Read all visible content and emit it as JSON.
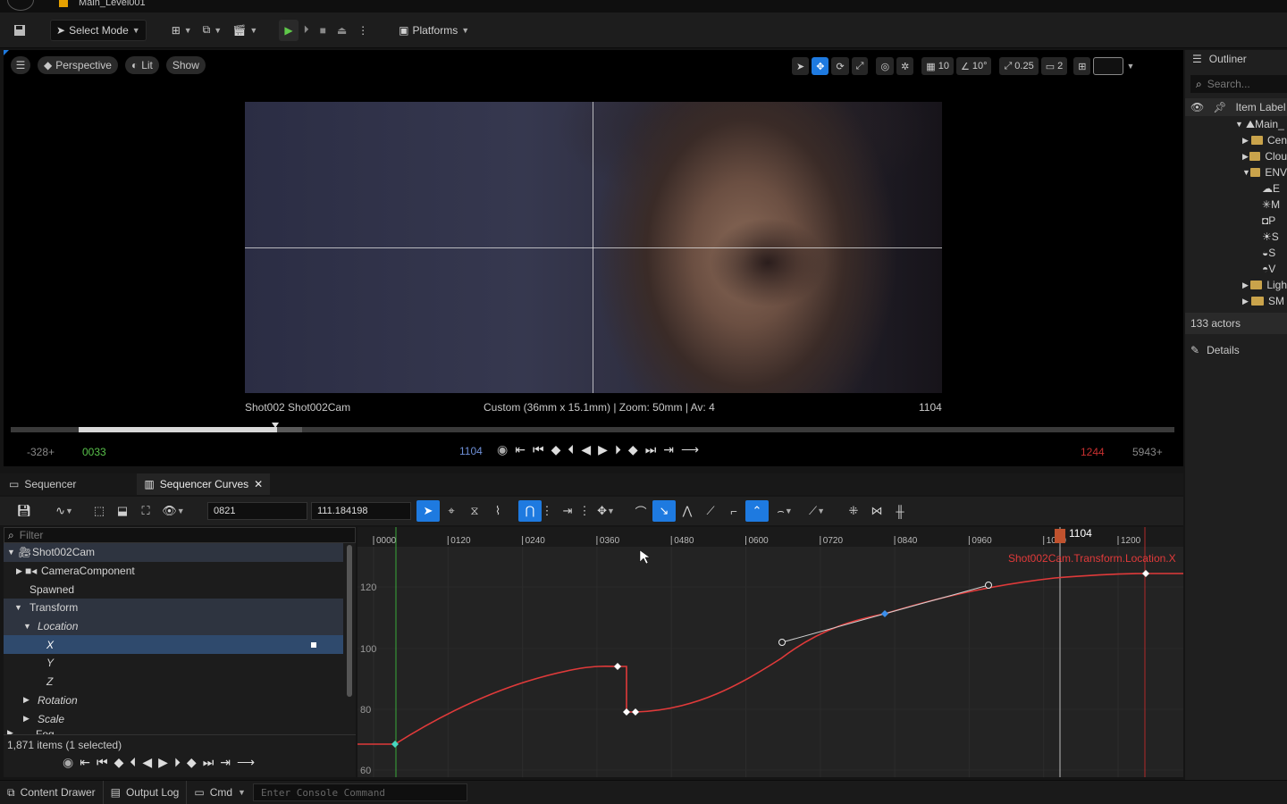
{
  "titlebar": {
    "level_name": "Main_Level001"
  },
  "toolbar": {
    "select_mode": "Select Mode",
    "platforms": "Platforms"
  },
  "viewport": {
    "perspective": "Perspective",
    "lit": "Lit",
    "show": "Show",
    "grid_snap": "10",
    "rot_snap": "10°",
    "scale_snap": "0.25",
    "camera_speed": "2",
    "cam_label": "Shot002  Shot002Cam",
    "cam_info": "Custom (36mm x 15.1mm) | Zoom: 50mm | Av: 4",
    "frame_label": "1104",
    "playback_progress": 0.23
  },
  "transport": {
    "start_out": "-328+",
    "start_in": "0033",
    "current": "1104",
    "end_in": "1244",
    "end_out": "5943+"
  },
  "tabs": {
    "sequencer": "Sequencer",
    "curves": "Sequencer Curves"
  },
  "seqtoolbar": {
    "frame_field": "0821",
    "value_field": "111.184198"
  },
  "tree": {
    "filter_placeholder": "Filter",
    "items": [
      {
        "label": "Shot002Cam"
      },
      {
        "label": "CameraComponent"
      },
      {
        "label": "Spawned"
      },
      {
        "label": "Transform"
      },
      {
        "label": "Location"
      },
      {
        "label": "X"
      },
      {
        "label": "Y"
      },
      {
        "label": "Z"
      },
      {
        "label": "Rotation"
      },
      {
        "label": "Scale"
      },
      {
        "label": "Fog"
      }
    ],
    "count": "1,871 items (1 selected)"
  },
  "curve": {
    "ticks": [
      "0000",
      "0120",
      "0240",
      "0360",
      "0480",
      "0600",
      "0720",
      "0840",
      "0960",
      "1080",
      "1200"
    ],
    "yticks": [
      "120",
      "100",
      "80",
      "60"
    ],
    "playhead": "1104",
    "curve_name": "Shot002Cam.Transform.Location.X",
    "curve_color": "#e03a3a"
  },
  "statusbar": {
    "content_drawer": "Content Drawer",
    "output_log": "Output Log",
    "cmd": "Cmd",
    "console_placeholder": "Enter Console Command"
  },
  "outliner": {
    "title": "Outliner",
    "search_placeholder": "Search...",
    "column": "Item Label",
    "items": [
      "Main_",
      "Cen",
      "Clou",
      "ENV",
      "E",
      "M",
      "P",
      "S",
      "S",
      "V",
      "Ligh",
      "SM"
    ],
    "count": "133 actors",
    "details": "Details"
  }
}
